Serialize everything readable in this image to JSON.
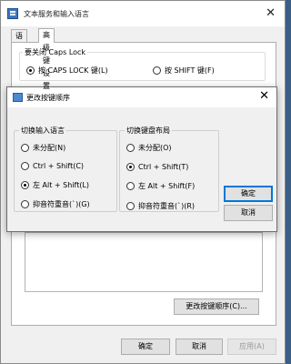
{
  "window": {
    "title": "文本服务和输入语言",
    "close": "✕"
  },
  "tabs": [
    {
      "label": "语言栏",
      "active": false
    },
    {
      "label": "高级键设置",
      "active": true
    }
  ],
  "caps_lock": {
    "legend": "要关闭 Caps Lock",
    "options": [
      {
        "label": "按 CAPS LOCK 键(L)",
        "checked": true
      },
      {
        "label": "按 SHIFT 键(F)",
        "checked": false
      }
    ]
  },
  "change_sequence_button": "更改按键顺序(C)...",
  "footer": {
    "ok": "确定",
    "cancel": "取消",
    "apply": "应用(A)"
  },
  "dialog": {
    "title": "更改按键顺序",
    "close": "✕",
    "input_language": {
      "legend": "切换输入语言",
      "options": [
        {
          "label": "未分配(N)",
          "checked": false
        },
        {
          "label": "Ctrl + Shift(C)",
          "checked": false
        },
        {
          "label": "左 Alt + Shift(L)",
          "checked": true
        },
        {
          "label": "抑音符重音(`)(G)",
          "checked": false
        }
      ]
    },
    "keyboard_layout": {
      "legend": "切换键盘布局",
      "options": [
        {
          "label": "未分配(O)",
          "checked": false
        },
        {
          "label": "Ctrl + Shift(T)",
          "checked": true
        },
        {
          "label": "左 Alt + Shift(F)",
          "checked": false
        },
        {
          "label": "抑音符重音(`)(R)",
          "checked": false
        }
      ]
    },
    "ok": "确定",
    "cancel": "取消"
  }
}
